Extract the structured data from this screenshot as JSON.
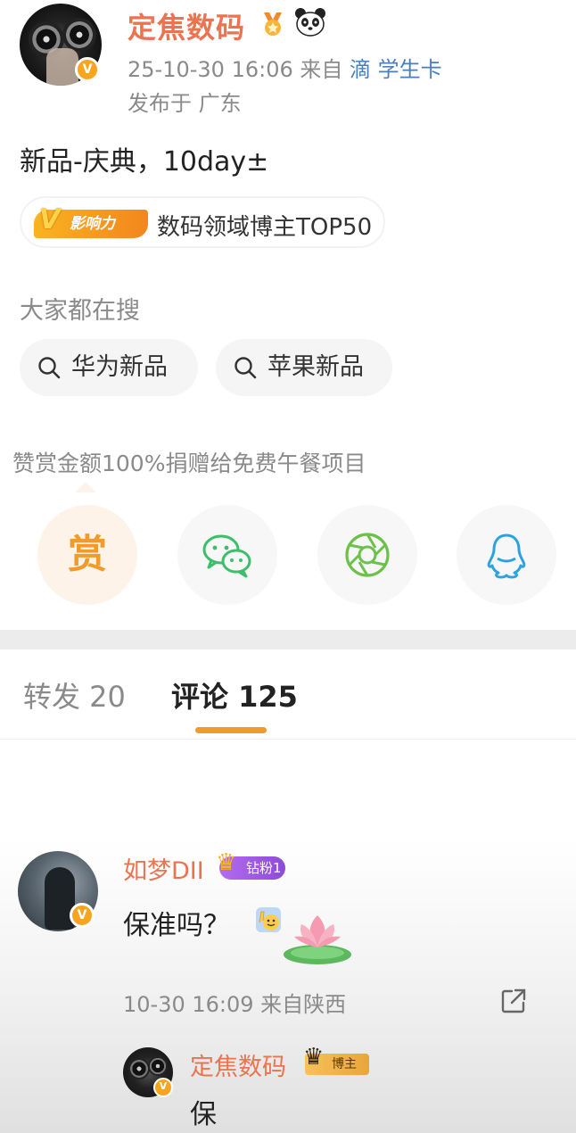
{
  "post": {
    "author": "定焦数码",
    "time": "25-10-30 16:06",
    "source_prefix": "来自",
    "source_app": "滴 学生卡",
    "location": "发布于 广东",
    "text": "新品-庆典，10day±",
    "influence_badge": "影响力",
    "influence_text": "数码领域博主TOP50"
  },
  "search": {
    "title": "大家都在搜",
    "chips": [
      "华为新品",
      "苹果新品"
    ]
  },
  "reward": {
    "text": "赞赏金额100%捐赠给免费午餐项目",
    "reward_label": "赏"
  },
  "tabs": {
    "repost": "转发 20",
    "comment": "评论 125"
  },
  "comments": [
    {
      "name": "如梦DII",
      "badge": "钻粉1",
      "text": "保准吗？",
      "meta": "10-30 16:09  来自陕西",
      "reply": {
        "name": "定焦数码",
        "badge": "博主",
        "text": "保"
      }
    }
  ],
  "colors": {
    "username": "#eb7350",
    "accent": "#f39a2c",
    "source_link": "#4a7fbb",
    "muted": "#8a8a8a"
  },
  "icons": [
    "medal-icon",
    "panda-icon",
    "search-icon",
    "wechat-icon",
    "moments-icon",
    "qq-icon",
    "wave-emoji-icon",
    "share-icon",
    "verified-icon",
    "crown-icon"
  ]
}
